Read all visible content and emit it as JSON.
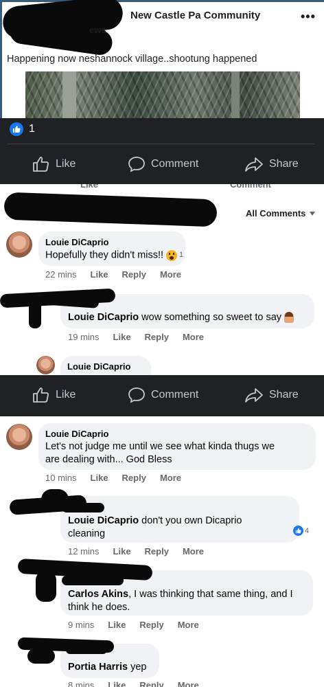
{
  "post": {
    "group_name": "New Castle Pa Community",
    "group_sub": "ews",
    "more": "•••",
    "text": "Happening now neshannock village..shootung happened"
  },
  "bar1": {
    "like_count": "1",
    "like_label": "Like",
    "comment_label": "Comment",
    "share_label": "Share"
  },
  "peek": {
    "like": "Like",
    "comment": "Comment"
  },
  "comments_header": {
    "filter_label": "All Comments"
  },
  "comments": [
    {
      "name": "Louie DiCaprio",
      "text": "Hopefully they didn't miss!!",
      "reaction_count": "1",
      "time": "22 mins",
      "like": "Like",
      "reply": "Reply",
      "more": "More"
    },
    {
      "mention": "Louie DiCaprio",
      "text": " wow something so sweet to say",
      "time": "19 mins",
      "like": "Like",
      "reply": "Reply",
      "more": "More"
    },
    {
      "name": "Louie DiCaprio"
    }
  ],
  "bar2": {
    "like_label": "Like",
    "comment_label": "Comment",
    "share_label": "Share"
  },
  "comments2": [
    {
      "name": "Louie DiCaprio",
      "text_line1": "Let's not judge me until we see what kinda thugs we",
      "text_line2": "are dealing with... God Bless",
      "time": "10 mins",
      "like": "Like",
      "reply": "Reply",
      "more": "More"
    },
    {
      "mention": "Louie DiCaprio",
      "text_line1": " don't you own Dicaprio",
      "text_line2": "cleaning",
      "reaction_count": "4",
      "time": "12 mins",
      "like": "Like",
      "reply": "Reply",
      "more": "More"
    },
    {
      "mention": "Carlos Akins",
      "text_line1": ", I was thinking that same thing, and I",
      "text_line2": "think he does.",
      "time": "9 mins",
      "like": "Like",
      "reply": "Reply",
      "more": "More"
    },
    {
      "mention": "Portia Harris",
      "text": " yep",
      "time": "8 mins",
      "like": "Like",
      "reply": "Reply",
      "more": "More"
    }
  ],
  "colors": {
    "dark_bar": "#202125",
    "accent_blue": "#1877f2",
    "bubble": "#f0f2f5"
  }
}
